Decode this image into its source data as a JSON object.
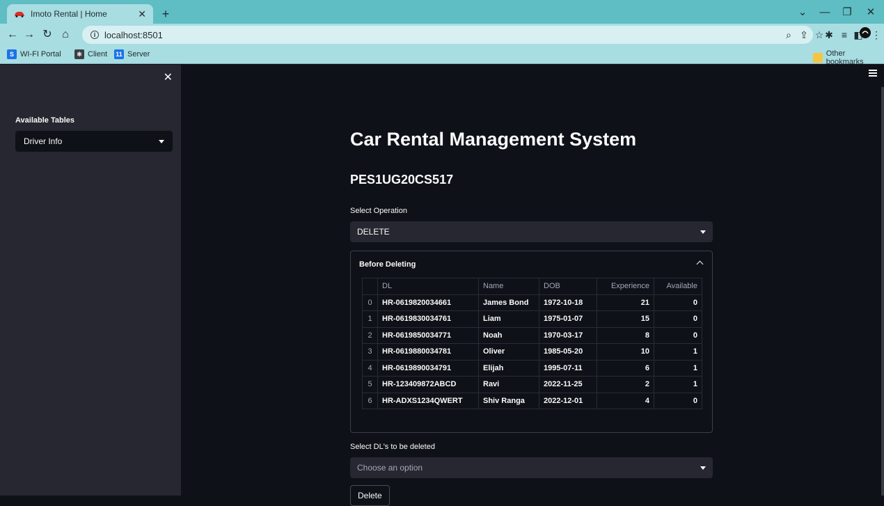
{
  "browser": {
    "tab_title": "Imoto Rental | Home",
    "url": "localhost:8501",
    "bookmarks": [
      {
        "label": "WI-FI Portal",
        "icon": "S",
        "color": "#1a73e8"
      },
      {
        "label": "Client",
        "icon": "",
        "color": "#3c4043"
      },
      {
        "label": "Server",
        "icon": "11",
        "color": "#1a73e8"
      }
    ],
    "other_bookmarks": "Other bookmarks"
  },
  "sidebar": {
    "label": "Available Tables",
    "selected": "Driver Info"
  },
  "main": {
    "title": "Car Rental Management System",
    "subtitle": "PES1UG20CS517",
    "operation_label": "Select Operation",
    "operation_value": "DELETE",
    "expander_title": "Before Deleting",
    "table": {
      "columns": [
        "DL",
        "Name",
        "DOB",
        "Experience",
        "Available"
      ],
      "rows": [
        {
          "idx": "0",
          "dl": "HR-0619820034661",
          "name": "James Bond",
          "dob": "1972-10-18",
          "experience": "21",
          "available": "0"
        },
        {
          "idx": "1",
          "dl": "HR-0619830034761",
          "name": "Liam",
          "dob": "1975-01-07",
          "experience": "15",
          "available": "0"
        },
        {
          "idx": "2",
          "dl": "HR-0619850034771",
          "name": "Noah",
          "dob": "1970-03-17",
          "experience": "8",
          "available": "0"
        },
        {
          "idx": "3",
          "dl": "HR-0619880034781",
          "name": "Oliver",
          "dob": "1985-05-20",
          "experience": "10",
          "available": "1"
        },
        {
          "idx": "4",
          "dl": "HR-0619890034791",
          "name": "Elijah",
          "dob": "1995-07-11",
          "experience": "6",
          "available": "1"
        },
        {
          "idx": "5",
          "dl": "HR-123409872ABCD",
          "name": "Ravi",
          "dob": "2022-11-25",
          "experience": "2",
          "available": "1"
        },
        {
          "idx": "6",
          "dl": "HR-ADXS1234QWERT",
          "name": "Shiv Ranga",
          "dob": "2022-12-01",
          "experience": "4",
          "available": "0"
        }
      ]
    },
    "dl_select_label": "Select DL's to be deleted",
    "dl_select_placeholder": "Choose an option",
    "delete_label": "Delete"
  }
}
